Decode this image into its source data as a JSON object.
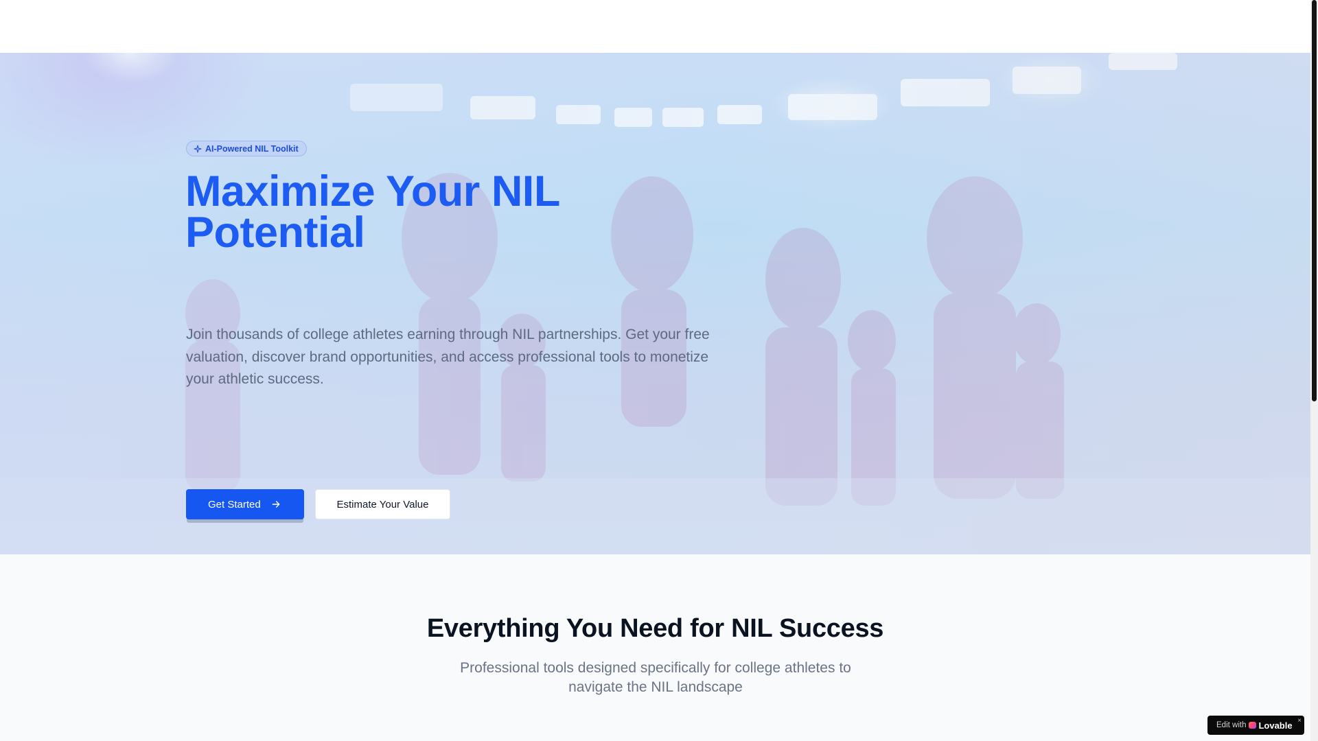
{
  "hero": {
    "badge_label": "AI-Powered NIL Toolkit",
    "title": "Maximize Your NIL Potential",
    "subtitle": "Join thousands of college athletes earning through NIL partnerships. Get your free valuation, discover brand opportunities, and access professional tools to monetize your athletic success.",
    "primary_button_label": "Get Started",
    "secondary_button_label": "Estimate Your Value"
  },
  "features": {
    "title": "Everything You Need for NIL Success",
    "subtitle": "Professional tools designed specifically for college athletes to navigate the NIL landscape"
  },
  "lovable_badge": {
    "prefix": "Edit with",
    "brand": "Lovable",
    "close": "×"
  },
  "colors": {
    "accent": "#1557f0",
    "title_blue": "#1d5cf2",
    "heading_dark": "#0b1220",
    "body_gray": "#5d6a80"
  },
  "icons": {
    "badge": "sparkle-icon",
    "primary_button": "arrow-right-icon",
    "lovable": "lovable-heart-icon"
  }
}
